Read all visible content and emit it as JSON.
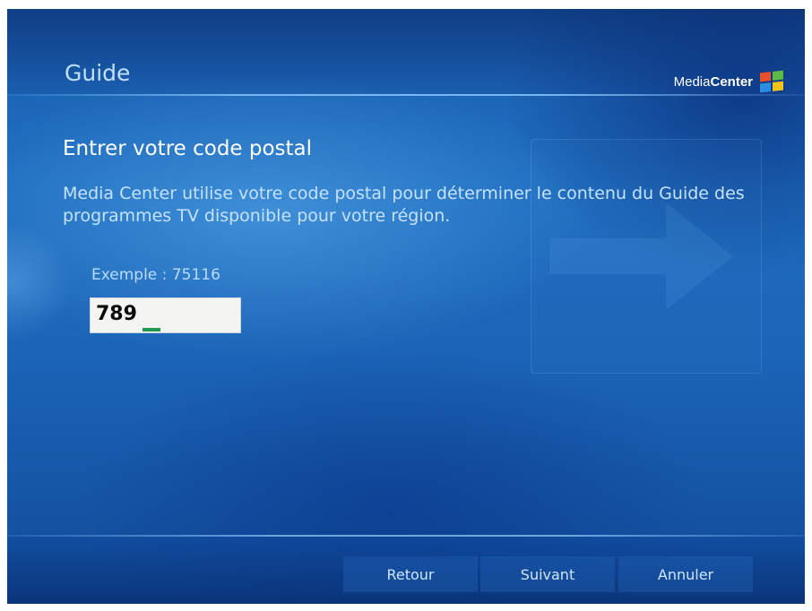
{
  "header": {
    "title": "Guide",
    "logo": {
      "prefix": "Media",
      "bold": "Center",
      "icon": "windows-flag-icon"
    }
  },
  "main": {
    "heading": "Entrer votre code postal",
    "description": "Media Center utilise votre code postal pour déterminer le contenu du Guide des programmes TV disponible pour votre région.",
    "example_label": "Exemple : 75116",
    "postal_code_value": "789"
  },
  "footer": {
    "buttons": [
      {
        "label": "Retour"
      },
      {
        "label": "Suivant"
      },
      {
        "label": "Annuler"
      }
    ]
  },
  "colors": {
    "background": "#1f6ec0",
    "title_text": "#bfe0ff",
    "cursor": "#1f9a53"
  }
}
